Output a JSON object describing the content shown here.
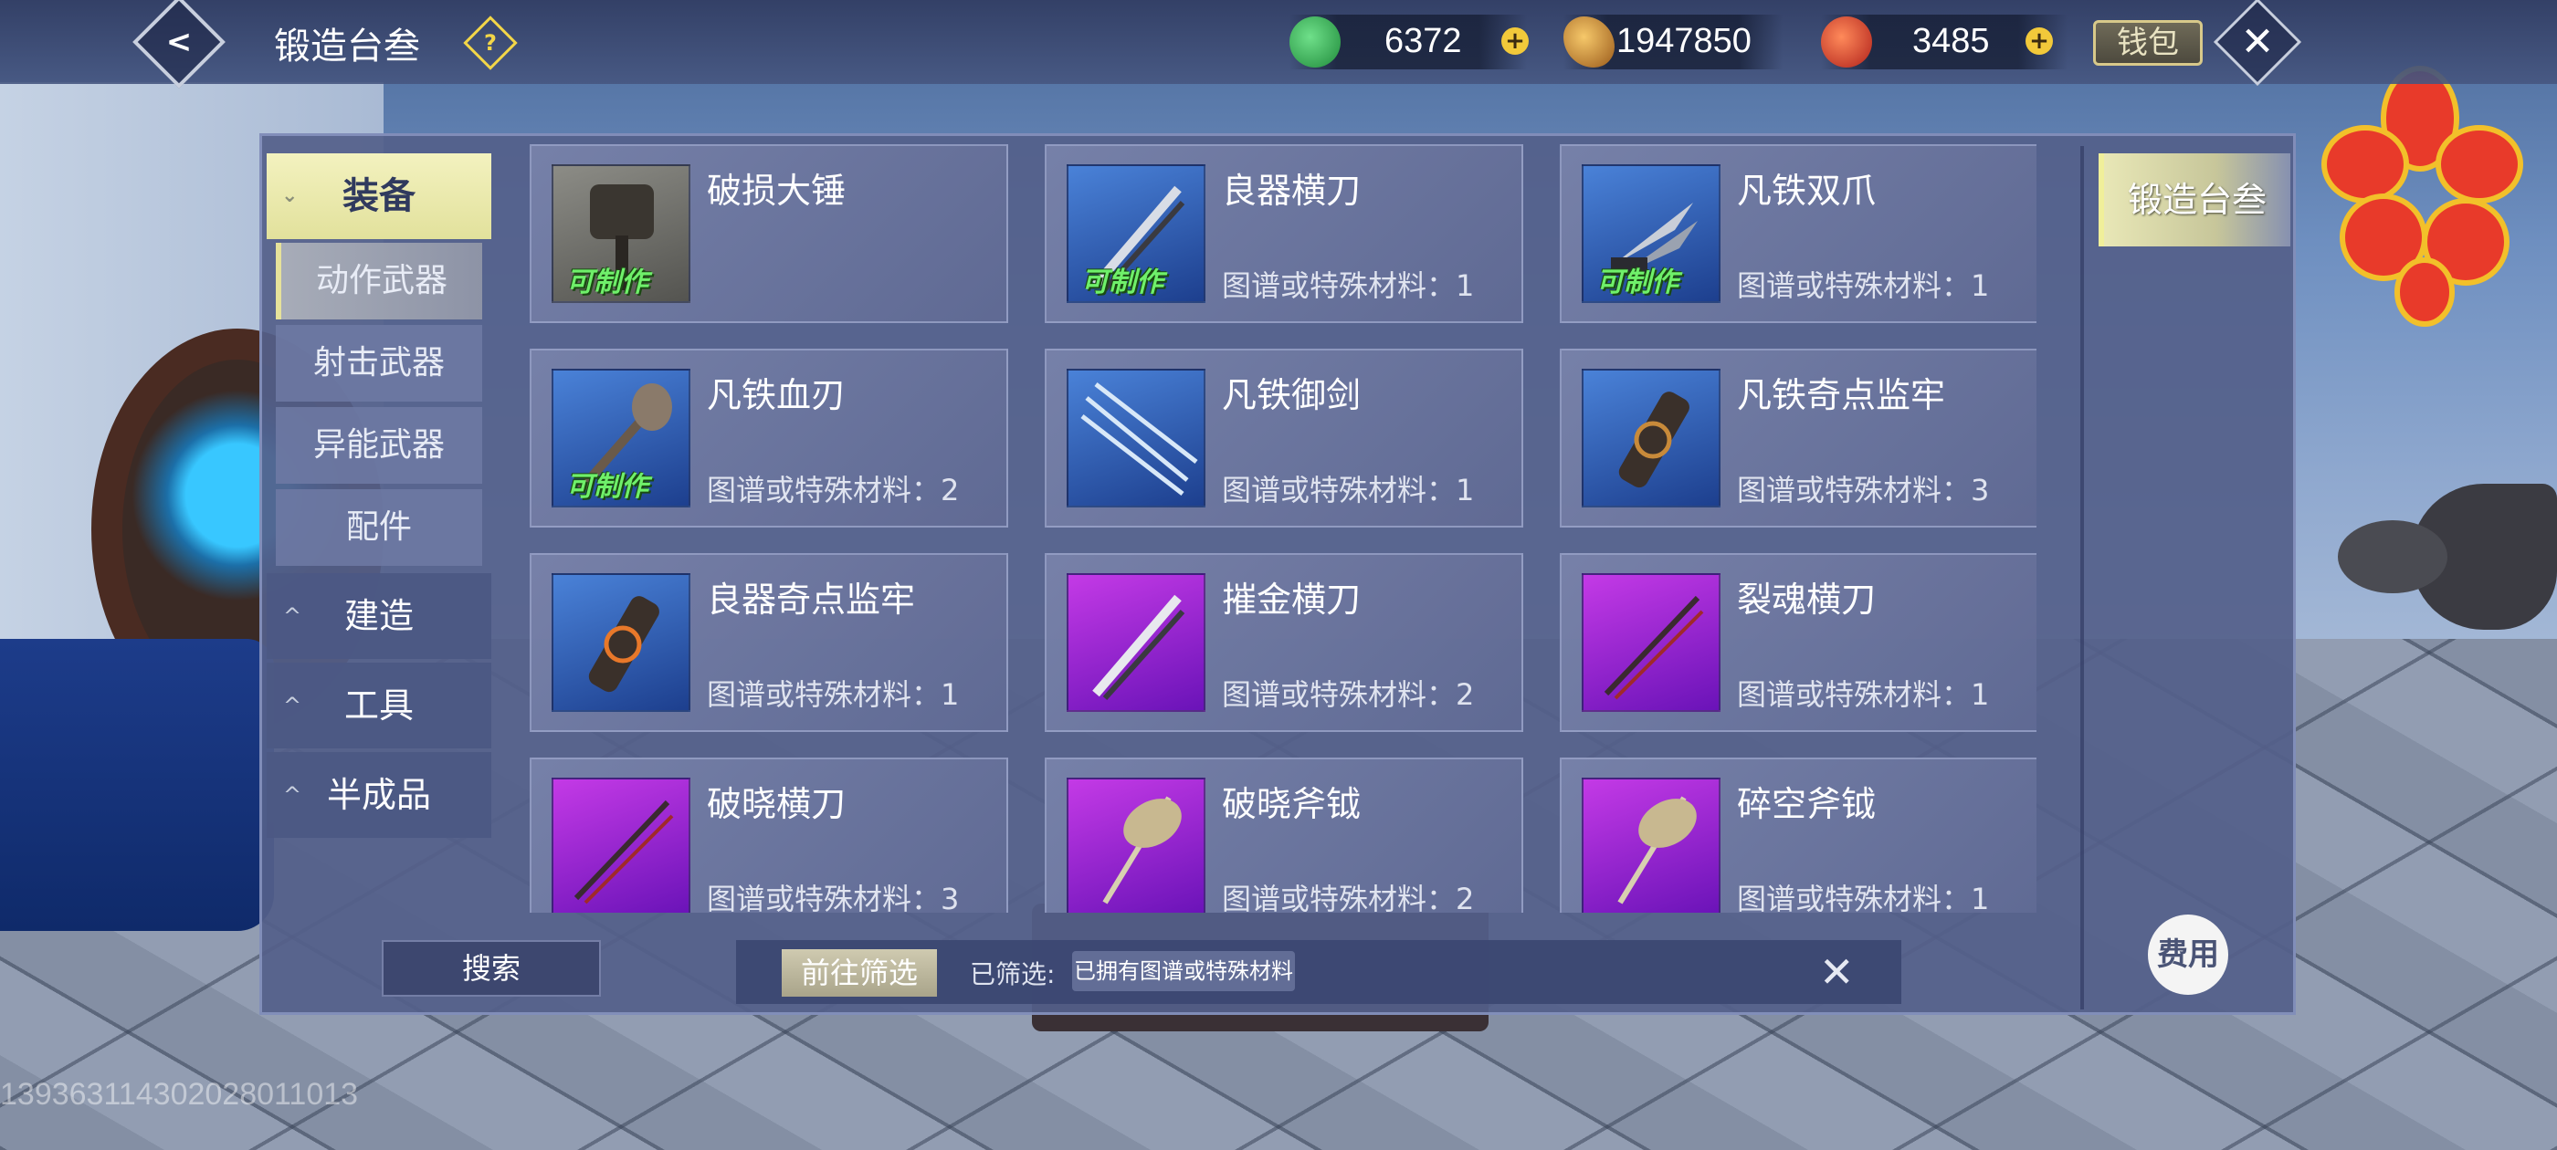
{
  "header": {
    "title": "锻造台叁",
    "back_icon": "back-arrow-icon",
    "help_symbol": "?",
    "wallet_label": "钱包"
  },
  "currencies": [
    {
      "name": "jade",
      "value": "6372",
      "color": "#2aa84a"
    },
    {
      "name": "gold",
      "value": "1947850",
      "color": "#c98a2a"
    },
    {
      "name": "fire",
      "value": "3485",
      "color": "#d8402a"
    }
  ],
  "nav": {
    "active_category": "装备",
    "sub_items": [
      {
        "label": "动作武器",
        "selected": true
      },
      {
        "label": "射击武器",
        "selected": false
      },
      {
        "label": "异能武器",
        "selected": false
      },
      {
        "label": "配件",
        "selected": false
      }
    ],
    "categories": [
      "建造",
      "工具",
      "半成品"
    ]
  },
  "items": [
    {
      "name": "破损大锤",
      "requirement": "",
      "craftable": "可制作",
      "rarity": "gray"
    },
    {
      "name": "良器横刀",
      "requirement": "图谱或特殊材料：1",
      "craftable": "可制作",
      "rarity": "blue"
    },
    {
      "name": "凡铁双爪",
      "requirement": "图谱或特殊材料：1",
      "craftable": "可制作",
      "rarity": "blue"
    },
    {
      "name": "凡铁血刃",
      "requirement": "图谱或特殊材料：2",
      "craftable": "可制作",
      "rarity": "blue"
    },
    {
      "name": "凡铁御剑",
      "requirement": "图谱或特殊材料：1",
      "craftable": "",
      "rarity": "blue"
    },
    {
      "name": "凡铁奇点监牢",
      "requirement": "图谱或特殊材料：3",
      "craftable": "",
      "rarity": "blue"
    },
    {
      "name": "良器奇点监牢",
      "requirement": "图谱或特殊材料：1",
      "craftable": "",
      "rarity": "blue"
    },
    {
      "name": "摧金横刀",
      "requirement": "图谱或特殊材料：2",
      "craftable": "",
      "rarity": "purple"
    },
    {
      "name": "裂魂横刀",
      "requirement": "图谱或特殊材料：1",
      "craftable": "",
      "rarity": "purple"
    },
    {
      "name": "破晓横刀",
      "requirement": "图谱或特殊材料：3",
      "craftable": "",
      "rarity": "purple"
    },
    {
      "name": "破晓斧钺",
      "requirement": "图谱或特殊材料：2",
      "craftable": "",
      "rarity": "purple"
    },
    {
      "name": "碎空斧钺",
      "requirement": "图谱或特殊材料：1",
      "craftable": "",
      "rarity": "purple"
    }
  ],
  "bottom": {
    "search_label": "搜索",
    "filter_go_label": "前往筛选",
    "filter_label": "已筛选:",
    "filter_chip": "已拥有图谱或特殊材料"
  },
  "side": {
    "tab_label": "锻造台叁",
    "fee_label": "费用"
  },
  "uid": "1393631143020280110​13"
}
